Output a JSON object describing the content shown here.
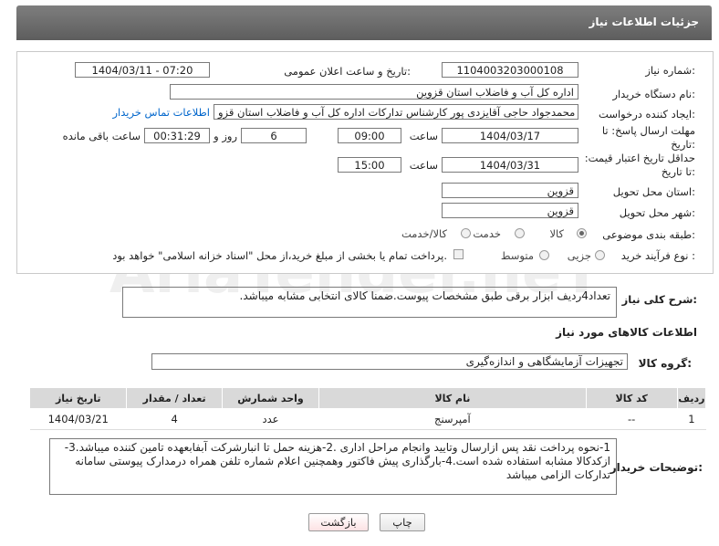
{
  "header": {
    "title": "جزئیات اطلاعات نیاز"
  },
  "form": {
    "need_number": {
      "label": "شماره نیاز:",
      "value": "1104003203000108"
    },
    "announce": {
      "label": "تاریخ و ساعت اعلان عمومی:",
      "value": "1404/03/11 - 07:20"
    },
    "buyer_org": {
      "label": "نام دستگاه خریدار:",
      "value": "اداره کل آب و فاضلاب استان قزوین"
    },
    "creator": {
      "label": "ایجاد کننده درخواست:",
      "value": "محمدجواد حاجی آقایزدی پور کارشناس تدارکات اداره کل آب و فاضلاب استان قزو",
      "contact_link": "اطلاعات تماس خریدار"
    },
    "deadline": {
      "label": "مهلت ارسال پاسخ: تا تاریخ:",
      "date": "1404/03/17",
      "time_label": "ساعت",
      "time": "09:00",
      "days": "6",
      "days_label": "روز و",
      "remaining": "00:31:29",
      "remaining_label": "ساعت باقی مانده"
    },
    "validity": {
      "label": "حداقل تاریخ اعتبار قیمت: تا تاریخ:",
      "date": "1404/03/31",
      "time_label": "ساعت",
      "time": "15:00"
    },
    "province": {
      "label": "استان محل تحویل:",
      "value": "قزوین"
    },
    "city": {
      "label": "شهر محل تحویل:",
      "value": "قزوین"
    },
    "category": {
      "label": "طبقه بندی موضوعی:",
      "options": [
        "کالا",
        "خدمت",
        "کالا/خدمت"
      ]
    },
    "process": {
      "label": "نوع فرآیند خرید :",
      "options": [
        "جزیی",
        "متوسط"
      ],
      "note": "پرداخت تمام یا بخشی از مبلغ خرید،از محل \"اسناد خزانه اسلامی\" خواهد بود."
    }
  },
  "description": {
    "label": "شرح کلی نیاز:",
    "value": "تعداد4ردیف ابزار برقی طبق مشخصات پیوست.ضمنا کالای انتخابی مشابه میباشد."
  },
  "goods": {
    "section_title": "اطلاعات کالاهای مورد نیاز",
    "group_label": "گروه کالا:",
    "group_value": "تجهیزات آزمایشگاهی و اندازه‌گیری",
    "columns": [
      "ردیف",
      "کد کالا",
      "نام کالا",
      "واحد شمارش",
      "تعداد / مقدار",
      "تاریخ نیاز"
    ],
    "rows": [
      {
        "row": "1",
        "code": "--",
        "name": "آمپرسنج",
        "unit": "عدد",
        "qty": "4",
        "date": "1404/03/21"
      }
    ]
  },
  "buyer_notes": {
    "label": "توضیحات خریدار:",
    "value": "1-نحوه پرداخت نقد پس ازارسال وتایید وانجام مراحل اداری .2-هزینه حمل تا انبارشرکت آبفابعهده تامین کننده میباشد.3-ازکدکالا مشابه استفاده شده است.4-بارگذاری پیش فاکتور وهمچنین اعلام شماره تلفن همراه درمدارک پیوستی سامانه تدارکات الزامی میباشد"
  },
  "buttons": {
    "print": "چاپ",
    "back": "بازگشت"
  },
  "watermark": "AriaTender.neT"
}
